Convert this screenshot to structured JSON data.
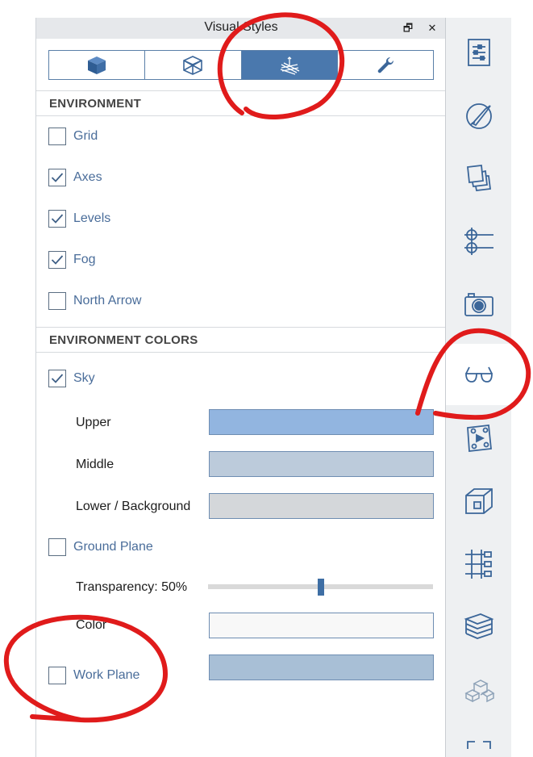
{
  "panel": {
    "title": "Visual Styles",
    "restore_glyph": "🗗",
    "close_glyph": "✕"
  },
  "tabs": [
    {
      "icon": "cube-solid-icon",
      "active": false
    },
    {
      "icon": "cube-wireframe-icon",
      "active": false
    },
    {
      "icon": "environment-axes-grid-icon",
      "active": true
    },
    {
      "icon": "wrench-icon",
      "active": false
    }
  ],
  "environment": {
    "heading": "ENVIRONMENT",
    "items": [
      {
        "label": "Grid",
        "checked": false
      },
      {
        "label": "Axes",
        "checked": true
      },
      {
        "label": "Levels",
        "checked": true
      },
      {
        "label": "Fog",
        "checked": true
      },
      {
        "label": "North Arrow",
        "checked": false
      }
    ]
  },
  "environment_colors": {
    "heading": "ENVIRONMENT COLORS",
    "sky": {
      "label": "Sky",
      "checked": true
    },
    "upper": {
      "label": "Upper",
      "color": "#92b5e0"
    },
    "middle": {
      "label": "Middle",
      "color": "#bccbdb"
    },
    "lower": {
      "label": "Lower / Background",
      "color": "#d4d7da"
    },
    "ground_plane": {
      "label": "Ground Plane",
      "checked": false
    },
    "transparency": {
      "label": "Transparency:",
      "value": "50%",
      "fraction": 0.5
    },
    "ground_color": {
      "label": "Color",
      "color": "#f8f8f8"
    },
    "work_plane": {
      "label": "Work Plane",
      "checked": false,
      "color": "#a8bfd6"
    }
  },
  "sidebar": {
    "items": [
      {
        "icon": "properties-sliders-icon",
        "active": false
      },
      {
        "icon": "style-brush-icon",
        "active": false
      },
      {
        "icon": "layers-stack-icon",
        "active": false
      },
      {
        "icon": "grid-lines-icon",
        "active": false
      },
      {
        "icon": "camera-icon",
        "active": false
      },
      {
        "icon": "glasses-icon",
        "active": true
      },
      {
        "icon": "animation-film-icon",
        "active": false
      },
      {
        "icon": "section-box-icon",
        "active": false
      },
      {
        "icon": "hierarchy-tree-icon",
        "active": false
      },
      {
        "icon": "layers-stack-3d-icon",
        "active": false
      },
      {
        "icon": "components-3d-icon",
        "active": false
      },
      {
        "icon": "frame-icon",
        "active": false
      }
    ]
  },
  "colors": {
    "accent": "#4a78ad",
    "annotation_red": "#e01b1b"
  }
}
